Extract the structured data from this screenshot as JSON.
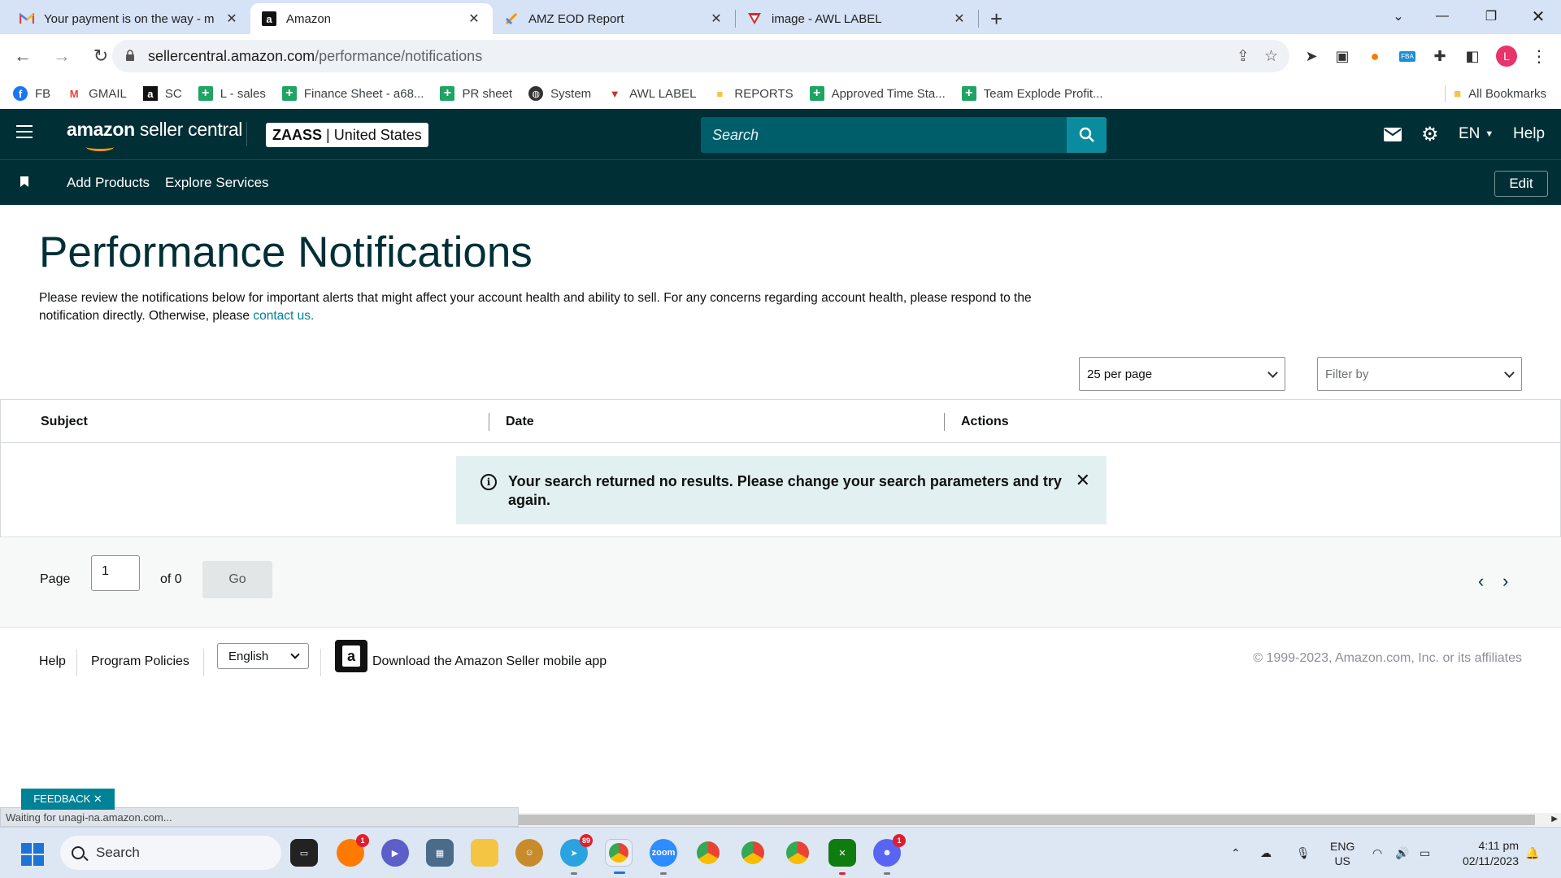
{
  "browser": {
    "tabs": [
      {
        "title": "Your payment is on the way - m",
        "icon": "gmail-icon",
        "active": false
      },
      {
        "title": "Amazon",
        "icon": "amazon-icon",
        "active": true
      },
      {
        "title": "AMZ EOD Report",
        "icon": "sheets-icon",
        "active": false
      },
      {
        "title": "image - AWL LABEL",
        "icon": "awl-icon",
        "active": false
      }
    ],
    "url_host": "sellercentral.amazon.com",
    "url_path": "/performance/notifications",
    "profile_initial": "L",
    "bookmarks": [
      {
        "label": "FB",
        "icon": "facebook-icon"
      },
      {
        "label": "GMAIL",
        "icon": "gmail-icon"
      },
      {
        "label": "SC",
        "icon": "amazon-icon"
      },
      {
        "label": "L - sales",
        "icon": "sheets-icon"
      },
      {
        "label": "Finance Sheet - a68...",
        "icon": "sheets-icon"
      },
      {
        "label": "PR sheet",
        "icon": "sheets-icon"
      },
      {
        "label": "System",
        "icon": "globe-icon"
      },
      {
        "label": "AWL LABEL",
        "icon": "awl-icon"
      },
      {
        "label": "REPORTS",
        "icon": "folder-icon"
      },
      {
        "label": "Approved Time Sta...",
        "icon": "sheets-icon"
      },
      {
        "label": "Team Explode Profit...",
        "icon": "sheets-icon"
      }
    ],
    "all_bookmarks": "All Bookmarks"
  },
  "header": {
    "logo_bold": "amazon",
    "logo_text": " seller central",
    "store_name": "ZAASS",
    "store_region": "| United States",
    "search_placeholder": "Search",
    "language": "EN",
    "help": "Help"
  },
  "nav": {
    "links": [
      "Add Products",
      "Explore Services"
    ],
    "edit": "Edit"
  },
  "page": {
    "title": "Performance Notifications",
    "intro": "Please review the notifications below for important alerts that might affect your account health and ability to sell. For any concerns regarding account health, please respond to the notification directly. Otherwise, please ",
    "intro_link": "contact us.",
    "per_page": "25 per page",
    "filter_placeholder": "Filter by"
  },
  "table": {
    "columns": [
      "Subject",
      "Date",
      "Actions"
    ],
    "empty_message": "Your search returned no results. Please change your search parameters and try again."
  },
  "pager": {
    "page_label": "Page",
    "current_page": "1",
    "of_label": "of 0",
    "go": "Go"
  },
  "footer": {
    "help": "Help",
    "program_policies": "Program Policies",
    "language": "English",
    "app_text": "Download the Amazon Seller mobile app",
    "copyright": "© 1999-2023, Amazon.com, Inc. or its affiliates"
  },
  "feedback": "FEEDBACK ✕",
  "status_text": "Waiting for unagi-na.amazon.com...",
  "taskbar": {
    "search": "Search",
    "lang_top": "ENG",
    "lang_bottom": "US",
    "time": "4:11 pm",
    "date": "02/11/2023",
    "badges": {
      "firefox": "1",
      "telegram": "89",
      "discord": "1"
    }
  },
  "colors": {
    "brand_dark": "#002f36",
    "search_bg": "#005e6b",
    "search_btn": "#0a8c9e",
    "link": "#008296",
    "alert_bg": "#e3f0f1"
  }
}
